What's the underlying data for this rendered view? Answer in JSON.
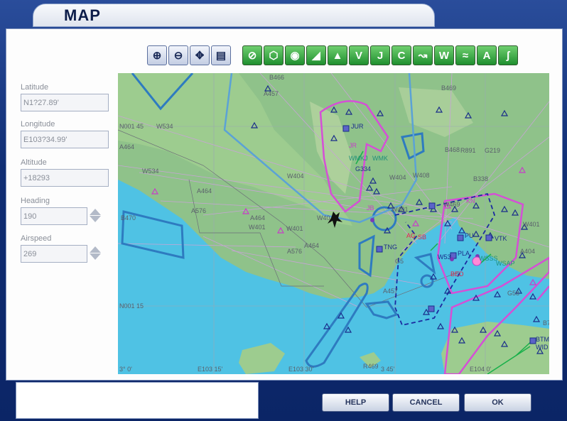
{
  "window": {
    "title": "MAP"
  },
  "toolbar": {
    "zoom_tools": [
      {
        "name": "zoom-in",
        "glyph": "⊕"
      },
      {
        "name": "zoom-out",
        "glyph": "⊖"
      },
      {
        "name": "center",
        "glyph": "✥"
      },
      {
        "name": "print",
        "glyph": "▤"
      }
    ],
    "layer_tools": [
      {
        "name": "airports",
        "glyph": "⊘"
      },
      {
        "name": "vor",
        "glyph": "⬡"
      },
      {
        "name": "ndb",
        "glyph": "◉"
      },
      {
        "name": "ils",
        "glyph": "◢"
      },
      {
        "name": "intersections",
        "glyph": "▲"
      },
      {
        "name": "victor-airways",
        "glyph": "V"
      },
      {
        "name": "jet-airways",
        "glyph": "J"
      },
      {
        "name": "airspace",
        "glyph": "C"
      },
      {
        "name": "flight-plan",
        "glyph": "↝"
      },
      {
        "name": "weather",
        "glyph": "W"
      },
      {
        "name": "terrain",
        "glyph": "≈"
      },
      {
        "name": "altitude-labels",
        "glyph": "A"
      },
      {
        "name": "airspace-boundaries",
        "glyph": "ʃ"
      }
    ]
  },
  "fields": {
    "latitude": {
      "label": "Latitude",
      "value": "N1?27.89'"
    },
    "longitude": {
      "label": "Longitude",
      "value": "E103?34.99'"
    },
    "altitude": {
      "label": "Altitude",
      "value": "+18293"
    },
    "heading": {
      "label": "Heading",
      "value": "190"
    },
    "airspeed": {
      "label": "Airspeed",
      "value": "269"
    }
  },
  "map": {
    "labels": {
      "b466": "B466",
      "a457": "A457",
      "b469": "B469",
      "n001_45": "N001 45",
      "w534a": "W534",
      "a464a": "A464",
      "w534b": "W534",
      "a464b": "A464",
      "a576a": "A576",
      "a464c": "A464",
      "w401a": "W401",
      "a576b": "A576",
      "a464d": "A464",
      "b470": "B470",
      "w401b": "W401",
      "n001_15": "N001 15",
      "e103_0": "3° 0'",
      "e103_15": "E103 15'",
      "e103_30": "E103 30'",
      "e103_45": "3 45'",
      "e104_0": "E104 0'",
      "r469": "R469",
      "jur": "JUR",
      "jr": "JR",
      "wmkj": "WMKJ",
      "wmk": "WMK",
      "g334": "G334",
      "w404": "W404",
      "w408": "W408",
      "b468": "B468",
      "r891": "R891",
      "g219": "G219",
      "b338": "B338",
      "w401c": "W401",
      "w469": "W469",
      "jb": "JB",
      "w40": "W40",
      "w401d": "W401",
      "tng": "TNG",
      "g5": "G5",
      "ag": "AG",
      "sb": "SB",
      "kn": "KN",
      "pu": "PU",
      "vtk": "VTK",
      "w401e": "W401",
      "w530": "W53",
      "pla": "PLA",
      "bed": "BED",
      "wsss": "WSSS",
      "wsap": "WSAP",
      "a404": "A404",
      "g580": "G58",
      "a457b": "A457",
      "b7": "B7",
      "btm": "BTM",
      "wid": "WID",
      "w404b": "W404"
    }
  },
  "buttons": {
    "help": "HELP",
    "cancel": "CANCEL",
    "ok": "OK"
  }
}
